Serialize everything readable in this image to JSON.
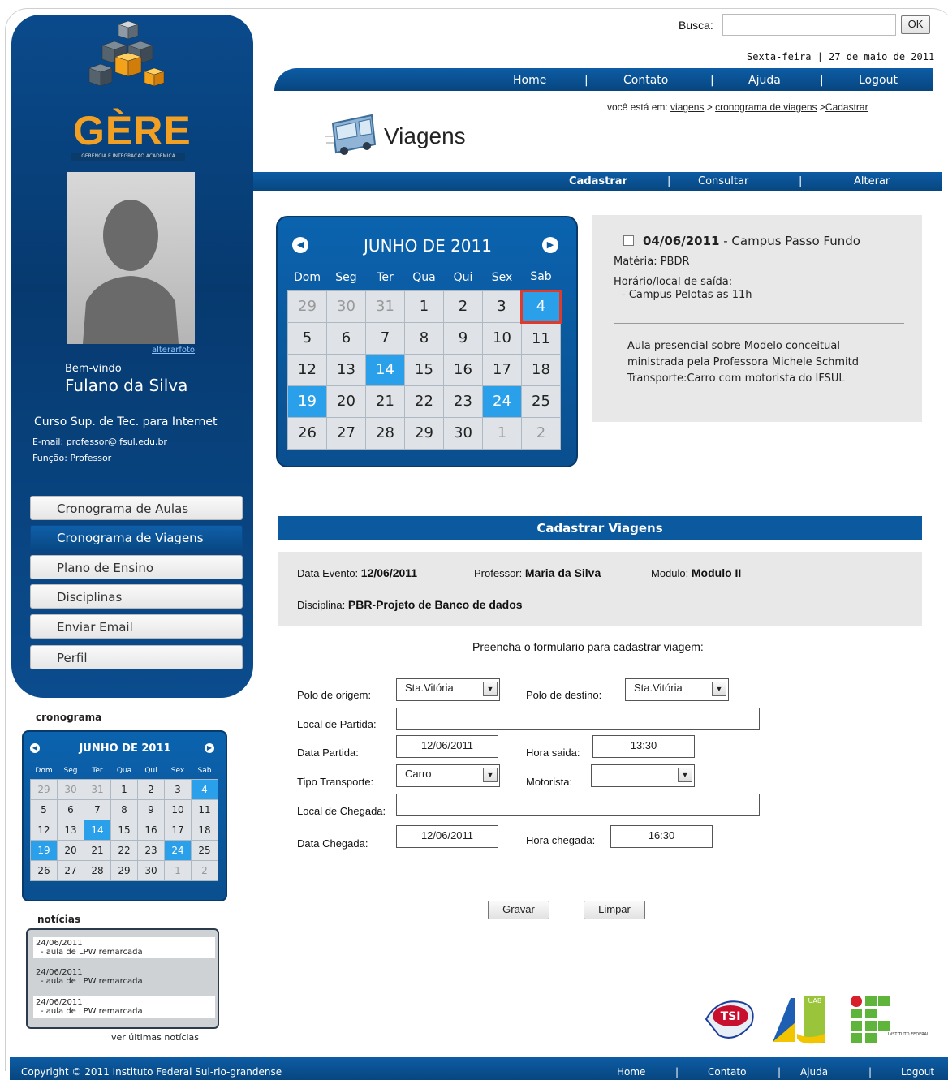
{
  "header": {
    "search_label": "Busca:",
    "search_value": "",
    "search_button": "OK",
    "date": "Sexta-feira | 27 de maio de 2011",
    "nav": [
      "Home",
      "|",
      "Contato",
      "|",
      "Ajuda",
      "|",
      "Logout"
    ],
    "breadcrumb_prefix": "você está em:",
    "bc1": "viagens",
    "sep1": ">",
    "bc2": "cronograma de viagens",
    "sep2": ">",
    "bc3": "Cadastrar",
    "page_title": "Viagens",
    "subnav": [
      "Cadastrar",
      "|",
      "Consultar",
      "|",
      "Alterar"
    ]
  },
  "sidebar": {
    "logo_text": "GÈRE",
    "logo_subtitle": "GERENCIA E INTEGRAÇÃO ACADÊMICA",
    "alter_photo": "alterarfoto",
    "welcome": "Bem-vindo",
    "user_name": "Fulano da Silva",
    "course": "Curso Sup. de Tec. para Internet",
    "email": "E-mail: professor@ifsul.edu.br",
    "role": "Função: Professor",
    "menu": [
      "Cronograma de Aulas",
      "Cronograma de Viagens",
      "Plano de Ensino",
      "Disciplinas",
      "Enviar Email",
      "Perfil"
    ],
    "cron_title": "cronograma",
    "news_title": "notícias",
    "news": [
      {
        "date": "24/06/2011",
        "text": "- aula de LPW remarcada"
      },
      {
        "date": "24/06/2011",
        "text": "- aula de LPW remarcada"
      },
      {
        "date": "24/06/2011",
        "text": "- aula de LPW remarcada"
      }
    ],
    "news_more": "ver últimas notícias"
  },
  "calendar": {
    "title": "JUNHO DE 2011",
    "days": [
      "Dom",
      "Seg",
      "Ter",
      "Qua",
      "Qui",
      "Sex",
      "Sab"
    ],
    "weeks": [
      [
        "29",
        "30",
        "31",
        "1",
        "2",
        "3",
        "4"
      ],
      [
        "5",
        "6",
        "7",
        "8",
        "9",
        "10",
        "11"
      ],
      [
        "12",
        "13",
        "14",
        "15",
        "16",
        "17",
        "18"
      ],
      [
        "19",
        "20",
        "21",
        "22",
        "23",
        "24",
        "25"
      ],
      [
        "26",
        "27",
        "28",
        "29",
        "30",
        "1",
        "2"
      ]
    ],
    "small_days": [
      "Dom",
      "Seg",
      "Ter",
      "Qua",
      "Qui",
      "Sex",
      "Sab"
    ]
  },
  "event": {
    "date": "04/06/2011",
    "place": " - Campus Passo Fundo",
    "materia": "Matéria: PBDR",
    "horario_label": "Horário/local de saída:",
    "horario": "- Campus Pelotas as 11h",
    "desc1": "Aula presencial sobre Modelo conceitual",
    "desc2": "ministrada pela Professora Michele Schmitd",
    "desc3": "Transporte:Carro com motorista do IFSUL"
  },
  "form": {
    "header": "Cadastrar  Viagens",
    "data_evento_label": "Data Evento:",
    "data_evento": "12/06/2011",
    "professor_label": "Professor:",
    "professor": "Maria da Silva",
    "modulo_label": "Modulo:",
    "modulo": "Modulo II",
    "disciplina_label": "Disciplina:",
    "disciplina": "PBR-Projeto de Banco de dados",
    "instructions": "Preencha o formulario para cadastrar viagem:",
    "polo_origem_label": "Polo de origem:",
    "polo_origem": "Sta.Vitória",
    "polo_destino_label": "Polo de destino:",
    "polo_destino": "Sta.Vitória",
    "local_partida_label": "Local de Partida:",
    "local_partida": "",
    "data_partida_label": "Data Partida:",
    "data_partida": "12/06/2011",
    "hora_saida_label": "Hora saida:",
    "hora_saida": "13:30",
    "tipo_transporte_label": "Tipo Transporte:",
    "tipo_transporte": "Carro",
    "motorista_label": "Motorista:",
    "motorista": "",
    "local_chegada_label": "Local de Chegada:",
    "local_chegada": "",
    "data_chegada_label": "Data Chegada:",
    "data_chegada": "12/06/2011",
    "hora_chegada_label": "Hora chegada:",
    "hora_chegada": "16:30",
    "gravar": "Gravar",
    "limpar": "Limpar"
  },
  "logos": {
    "tsi": "TSI",
    "uab": "UAB",
    "if": "INSTITUTO FEDERAL"
  },
  "footer": {
    "copyright": "Copyright © 2011 Instituto Federal Sul-rio-grandense",
    "links": [
      "Home",
      "|",
      "Contato",
      "|",
      "Ajuda",
      "|",
      "Logout"
    ]
  }
}
